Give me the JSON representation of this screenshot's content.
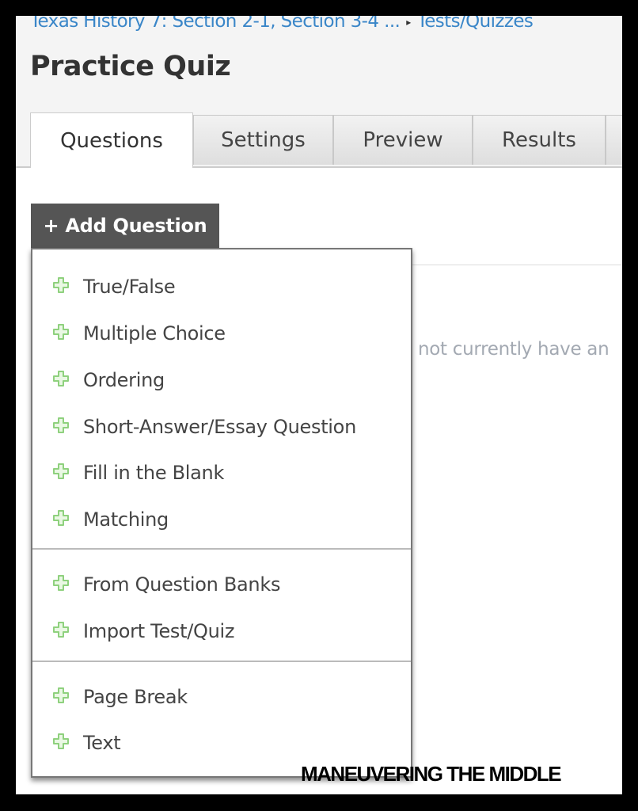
{
  "breadcrumb": {
    "course": "Texas History 7: Section 2-1, Section 3-4 ...",
    "separator": "▸",
    "section": "Tests/Quizzes"
  },
  "page_title": "Practice Quiz",
  "tabs": [
    {
      "label": "Questions",
      "active": true
    },
    {
      "label": "Settings",
      "active": false
    },
    {
      "label": "Preview",
      "active": false
    },
    {
      "label": "Results",
      "active": false
    }
  ],
  "add_question": {
    "label": "+ Add Question"
  },
  "empty_message": "not currently have an",
  "menu": {
    "icon": "green-plus-icon",
    "icon_color": "#8fd17e",
    "groups": [
      [
        "True/False",
        "Multiple Choice",
        "Ordering",
        "Short-Answer/Essay Question",
        "Fill in the Blank",
        "Matching"
      ],
      [
        "From Question Banks",
        "Import Test/Quiz"
      ],
      [
        "Page Break",
        "Text"
      ]
    ]
  },
  "watermark": "MANEUVERING THE MIDDLE"
}
